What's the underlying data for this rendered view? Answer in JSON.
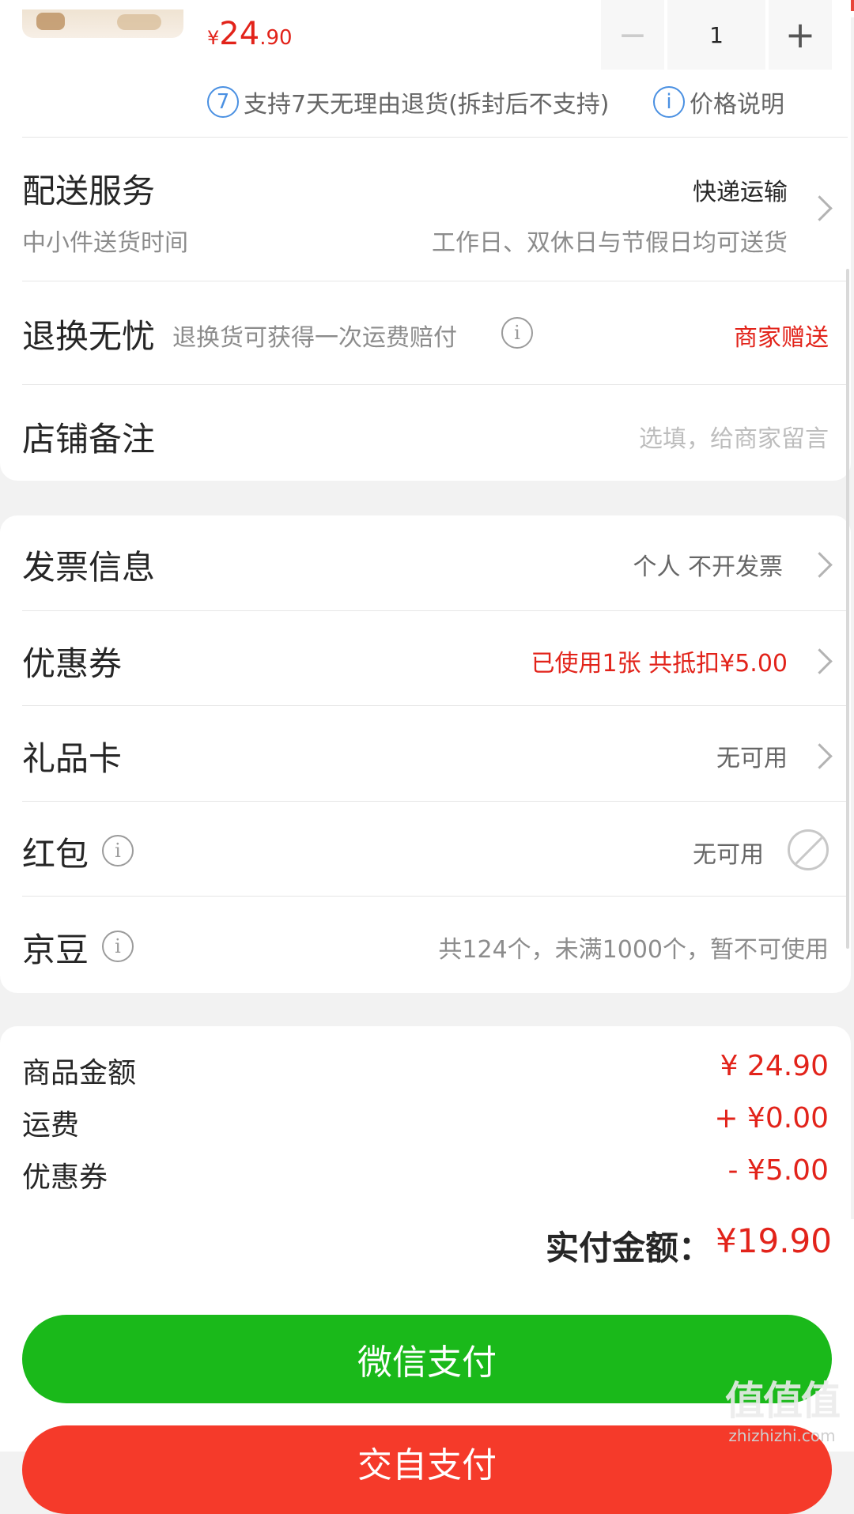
{
  "product": {
    "price_symbol": "¥",
    "price_int": "24",
    "price_dec": ".90",
    "quantity": "1",
    "minus": "−",
    "plus": "+"
  },
  "policy": {
    "return_badge": "7",
    "return_text": "支持7天无理由退货(拆封后不支持)",
    "info_glyph": "i",
    "price_explain": "价格说明"
  },
  "delivery": {
    "title": "配送服务",
    "method": "快递运输",
    "subtitle": "中小件送货时间",
    "time": "工作日、双休日与节假日均可送货"
  },
  "return_worry": {
    "title": "退换无忧",
    "desc": "退换货可获得一次运费赔付",
    "value": "商家赠送"
  },
  "shop_note": {
    "title": "店铺备注",
    "placeholder": "选填，给商家留言"
  },
  "invoice": {
    "title": "发票信息",
    "value": "个人 不开发票"
  },
  "coupon": {
    "title": "优惠券",
    "value": "已使用1张 共抵扣¥5.00"
  },
  "gift_card": {
    "title": "礼品卡",
    "value": "无可用"
  },
  "red_packet": {
    "title": "红包",
    "value": "无可用"
  },
  "jingdou": {
    "title": "京豆",
    "value": "共124个，未满1000个，暂不可使用"
  },
  "summary": {
    "goods_label": "商品金额",
    "goods_value": "¥ 24.90",
    "shipping_label": "运费",
    "shipping_value": "+ ¥0.00",
    "coupon_label": "优惠券",
    "coupon_value": "- ¥5.00"
  },
  "total": {
    "label": "实付金额：",
    "value": "¥19.90"
  },
  "buttons": {
    "wechat_pay": "微信支付",
    "other_pay": "交自支付"
  },
  "watermark": {
    "logo": "值值值",
    "url": "zhizhizhi.com"
  },
  "colors": {
    "price_red": "#e2231a",
    "wechat_green": "#1ab91a",
    "link_blue": "#4a90e2"
  }
}
